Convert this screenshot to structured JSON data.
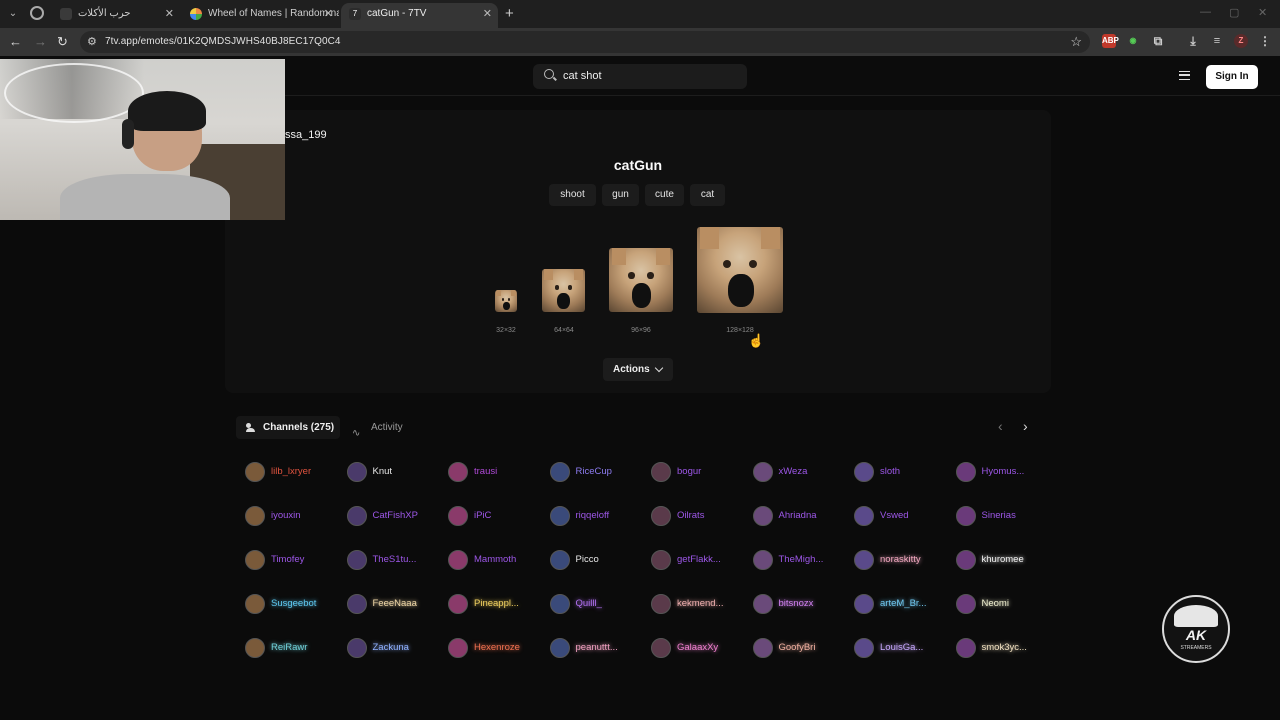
{
  "browser": {
    "tabs": [
      {
        "title": "حرب الأكلات",
        "active": false
      },
      {
        "title": "Wheel of Names | Random nam",
        "active": false
      },
      {
        "title": "catGun - 7TV",
        "active": true
      }
    ],
    "url": "7tv.app/emotes/01K2QMDSJWHS40BJ8EC17Q0C4"
  },
  "header": {
    "search_value": "cat shot",
    "sign_in_label": "Sign In"
  },
  "emote": {
    "owner": "ssa_199",
    "name": "catGun",
    "tags": [
      "shoot",
      "gun",
      "cute",
      "cat"
    ],
    "sizes": [
      "32×32",
      "64×64",
      "96×96",
      "128×128"
    ],
    "actions_label": "Actions"
  },
  "channels": {
    "tab_channels": "Channels (275)",
    "tab_activity": "Activity",
    "list": [
      {
        "name": "lilb_lxryer",
        "color": "#e0533f"
      },
      {
        "name": "Knut",
        "color": "#e8e8e8"
      },
      {
        "name": "trausi",
        "color": "#b04ad8"
      },
      {
        "name": "RiceCup",
        "color": "#8d7cf0"
      },
      {
        "name": "bogur",
        "color": "#9d57e8"
      },
      {
        "name": "xWeza",
        "color": "#9d57e8"
      },
      {
        "name": "sloth",
        "color": "#9d57e8"
      },
      {
        "name": "Hyomus...",
        "color": "#9d57e8"
      },
      {
        "name": "iyouxin",
        "color": "#9d57e8"
      },
      {
        "name": "CatFishXP",
        "color": "#9d57e8"
      },
      {
        "name": "iPiC",
        "color": "#9d57e8"
      },
      {
        "name": "riqqeloff",
        "color": "#9d57e8"
      },
      {
        "name": "Oilrats",
        "color": "#9d57e8"
      },
      {
        "name": "Ahriadna",
        "color": "#9d57e8"
      },
      {
        "name": "Vswed",
        "color": "#9d57e8"
      },
      {
        "name": "Sinerias",
        "color": "#9d57e8"
      },
      {
        "name": "Timofey",
        "color": "#9d57e8"
      },
      {
        "name": "TheS1tu...",
        "color": "#9d57e8"
      },
      {
        "name": "Mammoth",
        "color": "#9d57e8"
      },
      {
        "name": "Picco",
        "color": "#e8e8e8"
      },
      {
        "name": "getFlakk...",
        "color": "#9d57e8"
      },
      {
        "name": "TheMigh...",
        "color": "#9d57e8"
      },
      {
        "name": "noraskitty",
        "color": "#f2a8c0"
      },
      {
        "name": "khuromee",
        "color": "#f0f0f0"
      },
      {
        "name": "Susgeebot",
        "color": "#5ec8f0"
      },
      {
        "name": "FeeeNaaa",
        "color": "#f0d8a8"
      },
      {
        "name": "Pineappl...",
        "color": "#f0d060"
      },
      {
        "name": "Quilll_",
        "color": "#b070f0"
      },
      {
        "name": "kekmend...",
        "color": "#f0b0b0"
      },
      {
        "name": "bitsnozx",
        "color": "#d080f0"
      },
      {
        "name": "arteM_Br...",
        "color": "#70c8f0"
      },
      {
        "name": "Neomi",
        "color": "#f0f0d0"
      },
      {
        "name": "ReiRawr",
        "color": "#70d0d8"
      },
      {
        "name": "Zackuna",
        "color": "#8fb0ff"
      },
      {
        "name": "Hexenroze",
        "color": "#f07050"
      },
      {
        "name": "peanuttt...",
        "color": "#f0a0c0"
      },
      {
        "name": "GalaaxXy",
        "color": "#f080d0"
      },
      {
        "name": "GoofyBri",
        "color": "#f0b0a0"
      },
      {
        "name": "LouisGa...",
        "color": "#c8a8ff"
      },
      {
        "name": "smok3yc...",
        "color": "#f0e0c0"
      }
    ]
  },
  "overlay": {
    "logo_mark": "AK",
    "logo_sub": "STREAMERS"
  }
}
